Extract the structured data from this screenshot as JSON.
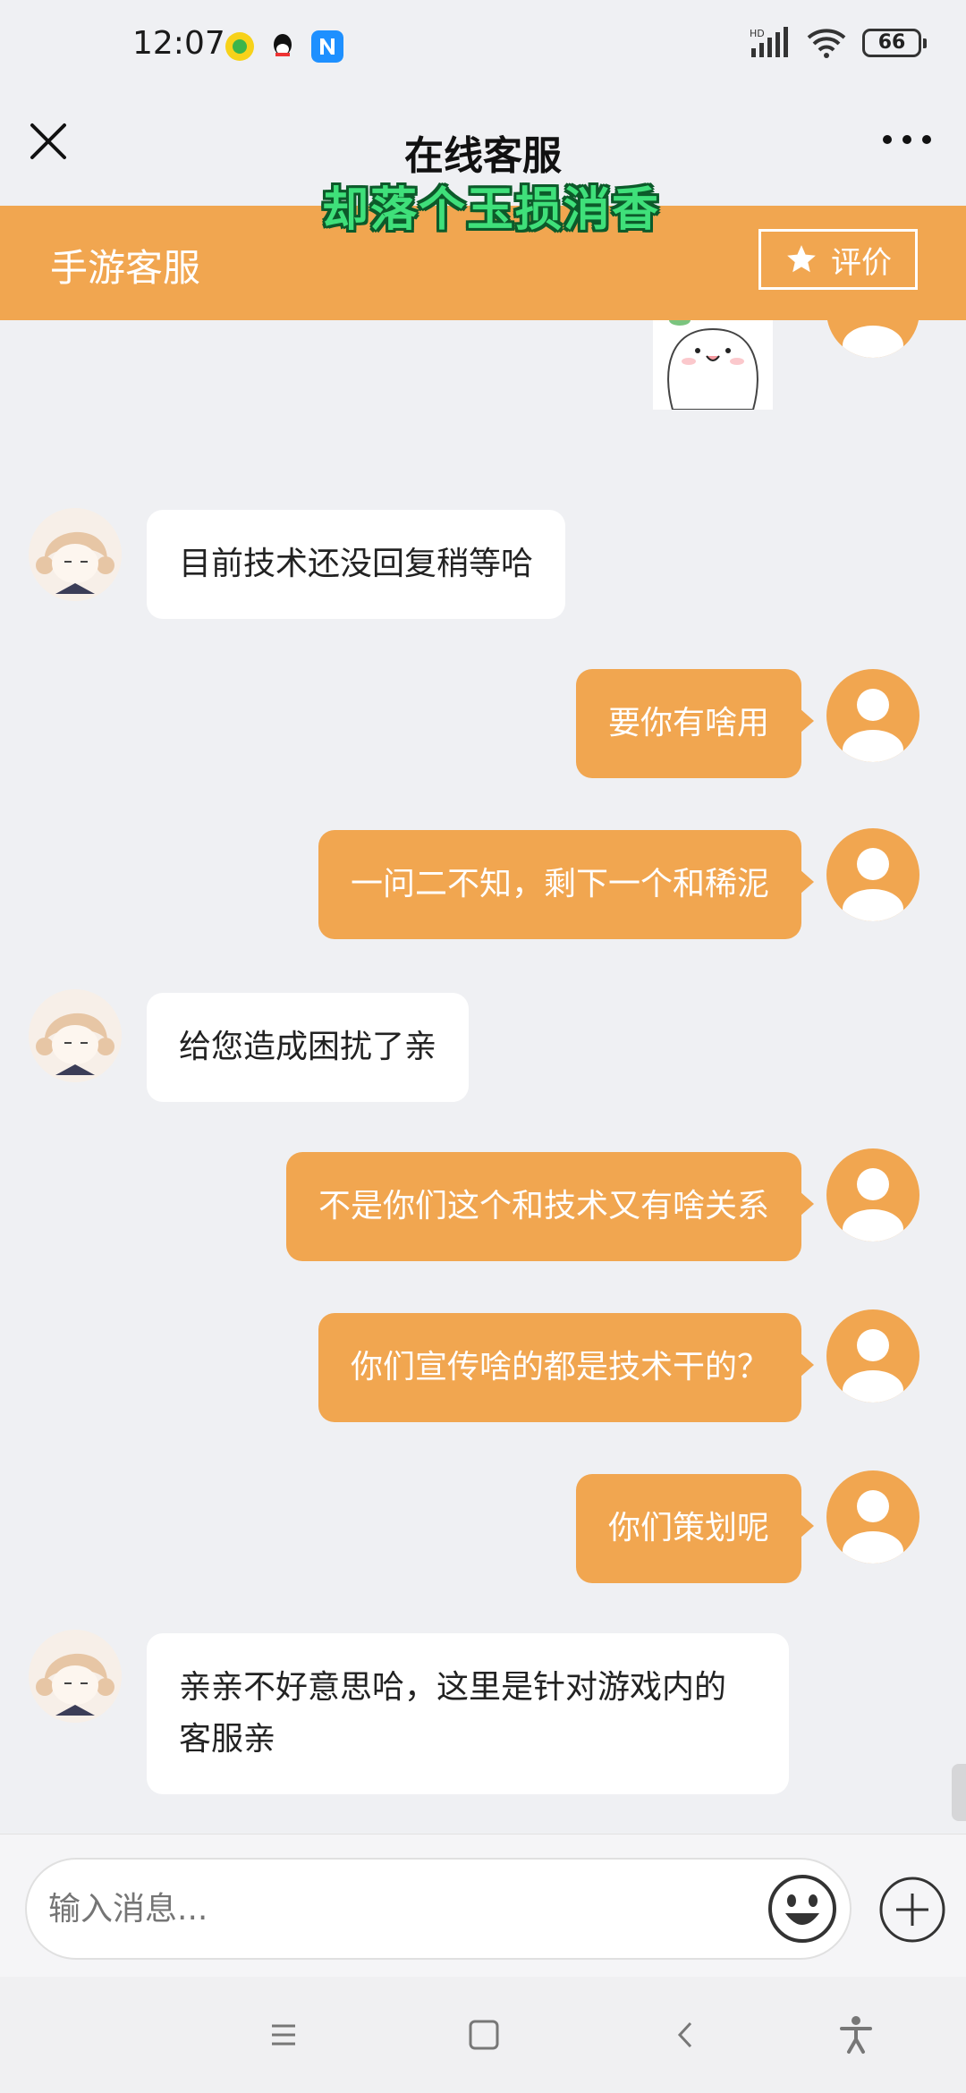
{
  "status_bar": {
    "time": "12:07",
    "signal_label": "HD",
    "battery": "66",
    "app_icons": [
      "music-app-icon",
      "qq-icon",
      "n-app-icon"
    ]
  },
  "nav": {
    "title": "在线客服",
    "overlay_caption": "却落个玉损消香"
  },
  "header": {
    "title": "手游客服",
    "rate_label": "评价"
  },
  "messages": [
    {
      "side": "user",
      "type": "sticker"
    },
    {
      "side": "agent",
      "text": "目前技术还没回复稍等哈"
    },
    {
      "side": "user",
      "text": "要你有啥用"
    },
    {
      "side": "user",
      "text": "一问二不知，剩下一个和稀泥"
    },
    {
      "side": "agent",
      "text": "给您造成困扰了亲"
    },
    {
      "side": "user",
      "text": "不是你们这个和技术又有啥关系"
    },
    {
      "side": "user",
      "text": "你们宣传啥的都是技术干的？"
    },
    {
      "side": "user",
      "text": "你们策划呢"
    },
    {
      "side": "agent",
      "text": "亲亲不好意思哈，这里是针对游戏内的客服亲"
    }
  ],
  "input": {
    "placeholder": "输入消息..."
  },
  "colors": {
    "accent": "#f1a650",
    "background": "#eff0f3",
    "overlay_text": "#3fe07a"
  }
}
